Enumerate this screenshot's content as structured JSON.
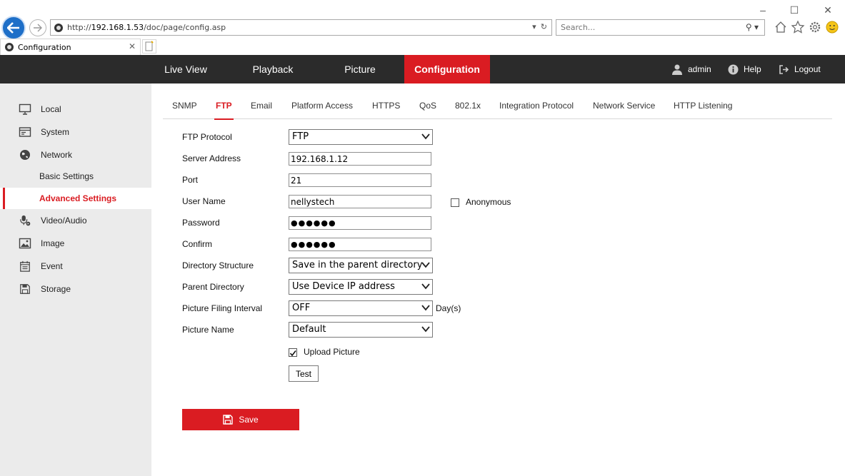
{
  "browser": {
    "url_prefix": "http://",
    "url_host": "192.168.1.53",
    "url_path": "/doc/page/config.asp",
    "search_placeholder": "Search...",
    "tab_title": "Configuration"
  },
  "header": {
    "nav": [
      "Live View",
      "Playback",
      "Picture",
      "Configuration"
    ],
    "active_nav": "Configuration",
    "user": "admin",
    "help": "Help",
    "logout": "Logout",
    "accent_color": "#da1c22"
  },
  "sidebar": {
    "items": [
      "Local",
      "System",
      "Network",
      "Video/Audio",
      "Image",
      "Event",
      "Storage"
    ],
    "network_sub": [
      "Basic Settings",
      "Advanced Settings"
    ],
    "active_sub": "Advanced Settings"
  },
  "tabs": [
    "SNMP",
    "FTP",
    "Email",
    "Platform Access",
    "HTTPS",
    "QoS",
    "802.1x",
    "Integration Protocol",
    "Network Service",
    "HTTP Listening"
  ],
  "active_tab": "FTP",
  "form": {
    "ftp_protocol": {
      "label": "FTP Protocol",
      "value": "FTP"
    },
    "server_address": {
      "label": "Server Address",
      "value": "192.168.1.12"
    },
    "port": {
      "label": "Port",
      "value": "21"
    },
    "user_name": {
      "label": "User Name",
      "value": "nellystech"
    },
    "anonymous": {
      "label": "Anonymous",
      "checked": false
    },
    "password": {
      "label": "Password",
      "value": "●●●●●●"
    },
    "confirm": {
      "label": "Confirm",
      "value": "●●●●●●"
    },
    "directory_structure": {
      "label": "Directory Structure",
      "value": "Save in the parent directory"
    },
    "parent_directory": {
      "label": "Parent Directory",
      "value": "Use Device IP address"
    },
    "picture_filing_interval": {
      "label": "Picture Filing Interval",
      "value": "OFF",
      "unit": "Day(s)"
    },
    "picture_name": {
      "label": "Picture Name",
      "value": "Default"
    },
    "upload_picture": {
      "label": "Upload Picture",
      "checked": true
    },
    "test_label": "Test",
    "save_label": "Save"
  }
}
